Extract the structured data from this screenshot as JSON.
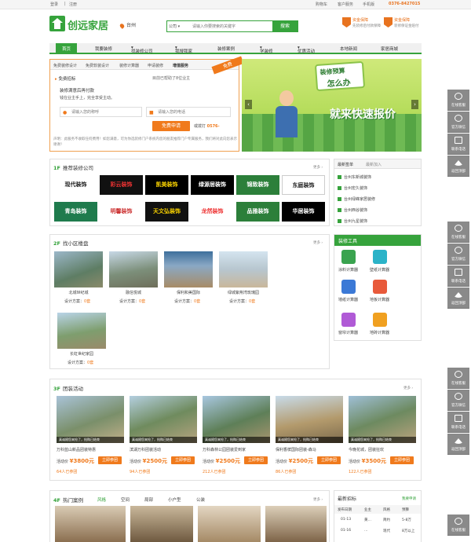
{
  "topbar": {
    "login": "登录",
    "sep": "|",
    "register": "注册",
    "cart": "购物车",
    "service": "客户服务",
    "mobile": "手机版",
    "hotline": "0376-8427015"
  },
  "logo": {
    "text": "创远家居"
  },
  "city": "台州",
  "search": {
    "category": "公司",
    "placeholder": "请输入你要搜索的关键字",
    "button": "搜索"
  },
  "promos": [
    {
      "t1": "资金保障",
      "t2": "先装修后付款保障"
    },
    {
      "t1": "资金保障",
      "t2": "装修保证金赔付"
    }
  ],
  "nav": [
    "首页",
    "我要装修",
    "找装修公司",
    "我搜我家",
    "装修案例",
    "学装修",
    "优惠活动",
    "本地新闻",
    "家居商城"
  ],
  "design": {
    "tabs": [
      "免费装修设计",
      "免费软装设计",
      "装修计算器",
      "申请装修",
      "增值服务"
    ],
    "ribbon": "免费",
    "label": "免费招标",
    "desc1": "装修满意后再付款",
    "desc2": "钱在业主手上，完全享受主动。",
    "counter": "目前已帮助了8位业主",
    "name_ph": "请输入您的称呼",
    "phone_ph": "请输入您的电话",
    "submit": "免费申请",
    "orcall": "或拨打",
    "phone": "0576-",
    "note": "声明：此服务不收取任何费用！如您满意，可为你选装修门户系统内您的朋友推荐门户专属服务，我们将对此向您表示谢谢！"
  },
  "banner": {
    "title1": "装修预算",
    "title2": "怎么办",
    "slogan": "就来快速报价"
  },
  "s1": {
    "num": "1F",
    "title": "推荐装修公司",
    "more": "更多"
  },
  "companies": [
    "现代装饰",
    "彩云装饰",
    "凯美装饰",
    "绿源居装饰",
    "锦致装饰",
    "东庭装饰",
    "青岛装饰",
    "明馨装饰",
    "天文弘装饰",
    "龙然装饰",
    "品雅装饰",
    "华居装饰"
  ],
  "newscard": {
    "tabs": [
      "最新签单",
      "最新加入"
    ],
    "items": [
      "台州东新城装饰",
      "台州宏久装饰",
      "台州绿峰家居装修",
      "台州西谷装饰",
      "台州九星装饰"
    ]
  },
  "s2": {
    "num": "2F",
    "title": "找小区楼盘",
    "more": "更多"
  },
  "estates": [
    {
      "name": "北城世纪城",
      "label": "设计方案",
      "count": "0套"
    },
    {
      "name": "融信悦城",
      "label": "设计方案",
      "count": "0套"
    },
    {
      "name": "保利和美国际",
      "label": "设计方案",
      "count": "0套"
    },
    {
      "name": "绿城紫荆湾玫瑰园",
      "label": "设计方案",
      "count": "0套"
    },
    {
      "name": "长虹世纪家园",
      "label": "设计方案",
      "count": "0套"
    }
  ],
  "tools": {
    "title": "装修工具",
    "items": [
      "涂料计算器",
      "壁纸计算器",
      "墙纸计算器",
      "地板计算器",
      "窗帘计算器",
      "地砖计算器"
    ],
    "colors": [
      "#3aa34f",
      "#2bb3c8",
      "#3b79d6",
      "#e85a3b",
      "#b05ad6",
      "#f0a020"
    ]
  },
  "s3": {
    "num": "3F",
    "title": "团装活动",
    "more": "更多"
  },
  "groups": [
    {
      "name": "万科蓝山新品团装特惠",
      "price": "¥3800元",
      "join": "立即参团",
      "count": "64人已参团"
    },
    {
      "name": "滨湖万科团装活动",
      "price": "¥2500元",
      "join": "立即参团",
      "count": "94人已参团"
    },
    {
      "name": "万科森林公园团装爱到家",
      "price": "¥2500元",
      "join": "立即参团",
      "count": "212人已参团"
    },
    {
      "name": "保利香槟国际团装-森马",
      "price": "¥2500元",
      "join": "立即参团",
      "count": "86人已参团"
    },
    {
      "name": "今晚花城，团装狂欢",
      "price": "¥3500元",
      "join": "立即参团",
      "count": "122人已参团"
    }
  ],
  "group_banner": "真诚随您来抢了，抢购已结束",
  "price_label": "活动价",
  "s4": {
    "num": "4F",
    "title": "热门案例",
    "tabs": [
      "风格",
      "空间",
      "局部",
      "小户型",
      "公装"
    ],
    "more": "更多"
  },
  "bids": {
    "title": "最新招标",
    "more": "我要申请",
    "headers": [
      "发布日期",
      "业主",
      "风格",
      "预算"
    ],
    "rows": [
      [
        "01-13",
        "黄…",
        "简约",
        "5-8万"
      ],
      [
        "01-16",
        "…",
        "现代",
        "8万以上"
      ]
    ]
  },
  "side": [
    "在线客服",
    "官方微信",
    "联系电话",
    "返回顶部"
  ]
}
